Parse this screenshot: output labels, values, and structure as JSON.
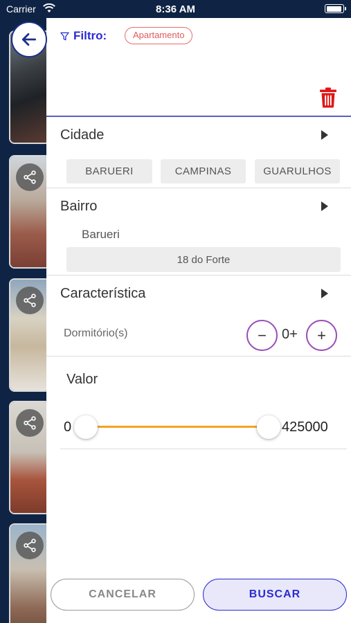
{
  "status_bar": {
    "carrier": "Carrier",
    "time": "8:36 AM",
    "battery_level": 0.95
  },
  "filter": {
    "label": "Filtro:",
    "active_chip": "Apartamento"
  },
  "sections": {
    "cidade": {
      "title": "Cidade",
      "options": [
        "BARUERI",
        "CAMPINAS",
        "GUARULHOS"
      ]
    },
    "bairro": {
      "title": "Bairro",
      "city_label": "Barueri",
      "option": "18 do Forte"
    },
    "caracteristica": {
      "title": "Característica",
      "dormitorio_label": "Dormitório(s)",
      "dormitorio_value": "0+",
      "minus_label": "−",
      "plus_label": "+"
    },
    "valor": {
      "title": "Valor",
      "min": "0",
      "max": "425000"
    }
  },
  "footer": {
    "cancel_label": "CANCELAR",
    "search_label": "BUSCAR"
  },
  "colors": {
    "accent": "#2a2ad4",
    "chip": "#e25a5a",
    "trash": "#e01515",
    "slider": "#f3a41f",
    "stepper_border": "#9b4fb8",
    "background": "#0f2444"
  },
  "icons": [
    "wifi-icon",
    "battery-icon",
    "back-arrow-icon",
    "filter-icon",
    "trash-icon",
    "share-icon",
    "chevron-right-icon"
  ]
}
